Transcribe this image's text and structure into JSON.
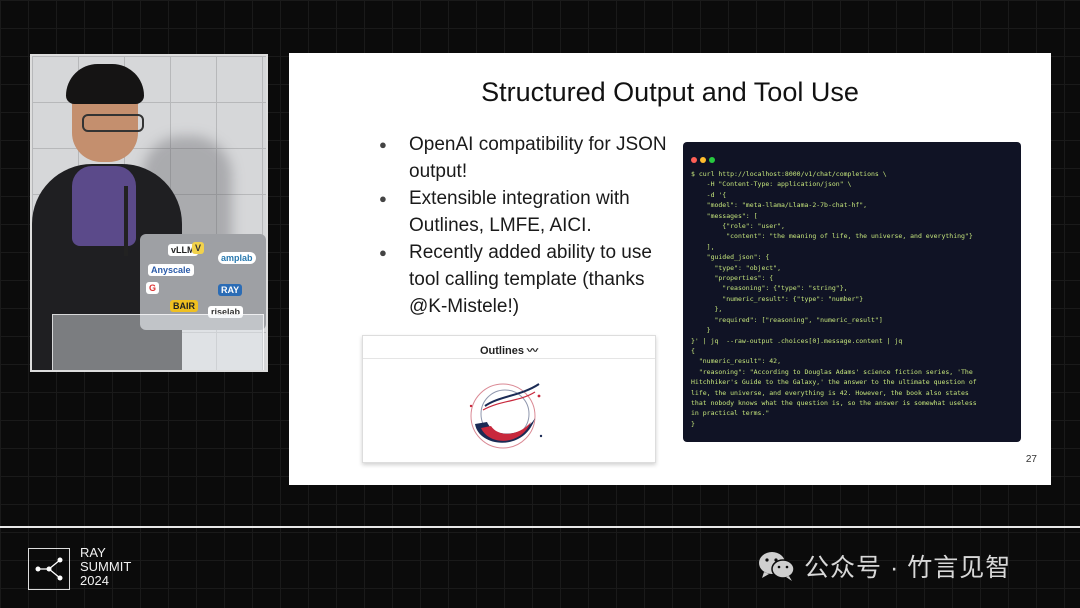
{
  "slide": {
    "title": "Structured Output and Tool Use",
    "bullets": [
      "OpenAI compatibility for JSON output!",
      "Extensible integration with Outlines, LMFE, AICI.",
      "Recently added ability to use tool calling template (thanks @K-Mistele!)"
    ],
    "outlines_card_title": "Outlines 〰",
    "page_number": "27",
    "code_lines": [
      "$ curl http://localhost:8000/v1/chat/completions \\",
      "    -H \"Content-Type: application/json\" \\",
      "    -d '{",
      "    \"model\": \"meta-llama/Llama-2-7b-chat-hf\",",
      "    \"messages\": [",
      "        {\"role\": \"user\",",
      "         \"content\": \"the meaning of life, the universe, and everything\"}",
      "    ],",
      "    \"guided_json\": {",
      "      \"type\": \"object\",",
      "      \"properties\": {",
      "        \"reasoning\": {\"type\": \"string\"},",
      "        \"numeric_result\": {\"type\": \"number\"}",
      "      },",
      "      \"required\": [\"reasoning\", \"numeric_result\"]",
      "    }",
      "}' | jq  --raw-output .choices[0].message.content | jq",
      "{",
      "  \"numeric_result\": 42,",
      "  \"reasoning\": \"According to Douglas Adams' science fiction series, 'The",
      "Hitchhiker's Guide to the Galaxy,' the answer to the ultimate question of",
      "life, the universe, and everything is 42. However, the book also states",
      "that nobody knows what the question is, so the answer is somewhat useless",
      "in practical terms.\"",
      "}"
    ],
    "window_dot_colors": [
      "#ff5f56",
      "#ffbd2e",
      "#27c93f"
    ]
  },
  "video": {
    "laptop_stickers": [
      "vLLM",
      "V",
      "amplab",
      "Anyscale",
      "G",
      "RAY",
      "BAIR",
      "riselab"
    ]
  },
  "branding": {
    "event_lines": [
      "RAY",
      "SUMMIT",
      "2024"
    ],
    "watermark": "公众号 · 竹言见智",
    "icon": "wechat-icon"
  },
  "colors": {
    "background": "#0b0b0b",
    "slide": "#ffffff",
    "code_background": "#101325",
    "code_text": "#c6e67c"
  }
}
